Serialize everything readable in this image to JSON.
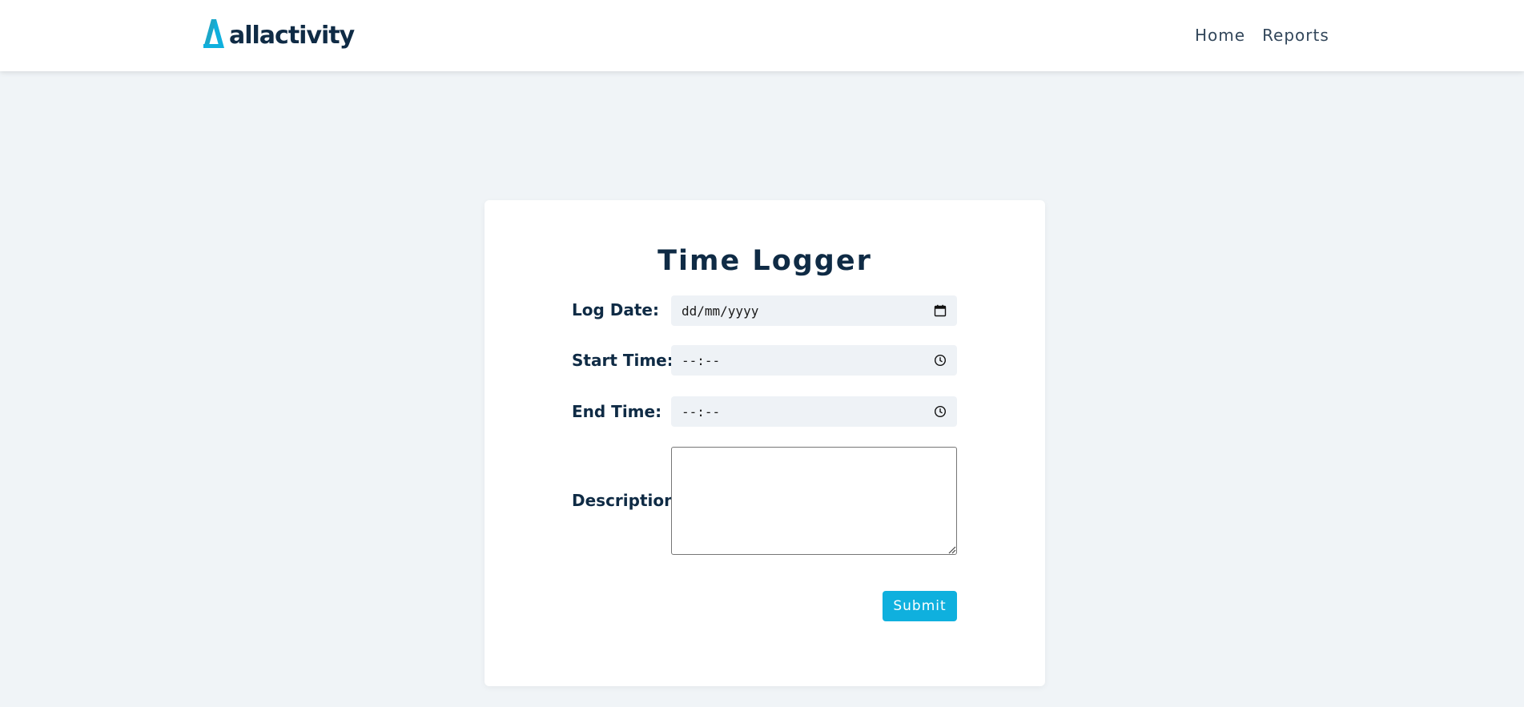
{
  "brand": {
    "name": "allactivity",
    "icon": "allactivity-logo-icon",
    "accent_color": "#0fb0de"
  },
  "nav": {
    "links": [
      {
        "label": "Home"
      },
      {
        "label": "Reports"
      }
    ]
  },
  "form": {
    "title": "Time Logger",
    "log_date": {
      "label": "Log Date:",
      "placeholder": "dd/mm/yyyy",
      "icon": "calendar-icon"
    },
    "start_time": {
      "label": "Start Time:",
      "placeholder": "--:--",
      "icon": "clock-icon"
    },
    "end_time": {
      "label": "End Time:",
      "placeholder": "--:--",
      "icon": "clock-icon"
    },
    "description": {
      "label": "Description:",
      "value": ""
    },
    "submit_label": "Submit"
  },
  "colors": {
    "page_background": "#f0f4f7",
    "text_dark": "#0f2b45",
    "field_background": "#eef2f6"
  }
}
